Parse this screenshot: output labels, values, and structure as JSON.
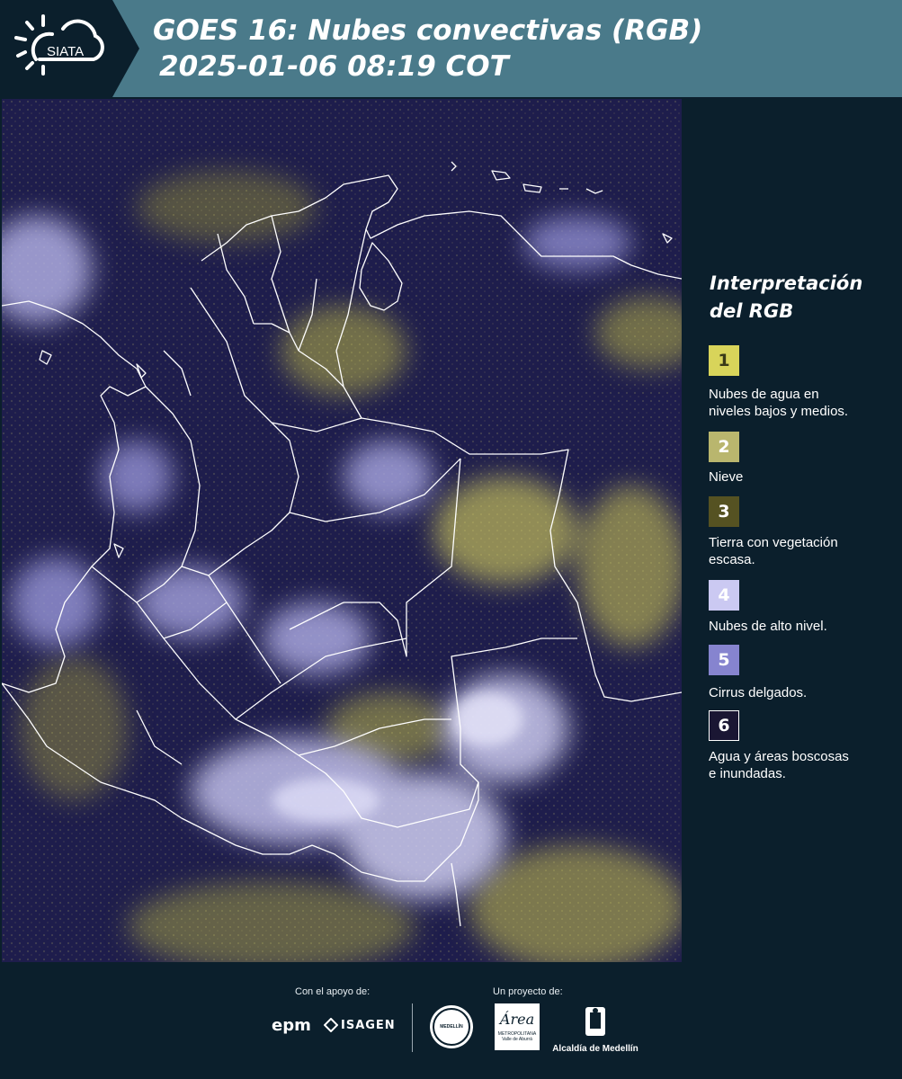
{
  "header": {
    "logo_text": "SIATA",
    "title_line1": "GOES 16: Nubes convectivas (RGB)",
    "title_line2": "2025-01-06 08:19 COT"
  },
  "legend": {
    "title_line1": "Interpretación",
    "title_line2": "del RGB",
    "items": [
      {
        "number": "1",
        "color": "#d8d45a",
        "text_color": "#3a3a18",
        "line1": "Nubes de agua en",
        "line2": "niveles bajos y medios."
      },
      {
        "number": "2",
        "color": "#b9b66e",
        "text_color": "#ffffff",
        "line1": "Nieve",
        "line2": ""
      },
      {
        "number": "3",
        "color": "#555222",
        "text_color": "#ffffff",
        "line1": "Tierra con vegetación",
        "line2": "escasa."
      },
      {
        "number": "4",
        "color": "#cbc9f2",
        "text_color": "#ffffff",
        "line1": "Nubes de alto nivel.",
        "line2": ""
      },
      {
        "number": "5",
        "color": "#8684cf",
        "text_color": "#ffffff",
        "line1": "Cirrus delgados.",
        "line2": ""
      },
      {
        "number": "6",
        "color": "#1a1633",
        "text_color": "#ffffff",
        "line1": "Agua y áreas boscosas",
        "line2": "e inundadas."
      }
    ]
  },
  "footer": {
    "support_label": "Con el apoyo de:",
    "project_label": "Un proyecto de:",
    "sponsors": [
      "epm",
      "ISAGEN"
    ],
    "area_logo_text": "Área",
    "area_logo_sub1": "METROPOLITANA",
    "area_logo_sub2": "Valle de Aburrá",
    "alcaldia_label": "Alcaldía de Medellín",
    "seal_text": "MEDELLÍN"
  },
  "map": {
    "colors": {
      "background": "#1b1b4a",
      "cloud_high": "#c8c6f0",
      "cloud_low": "#d5d068",
      "border": "#ffffff"
    }
  }
}
